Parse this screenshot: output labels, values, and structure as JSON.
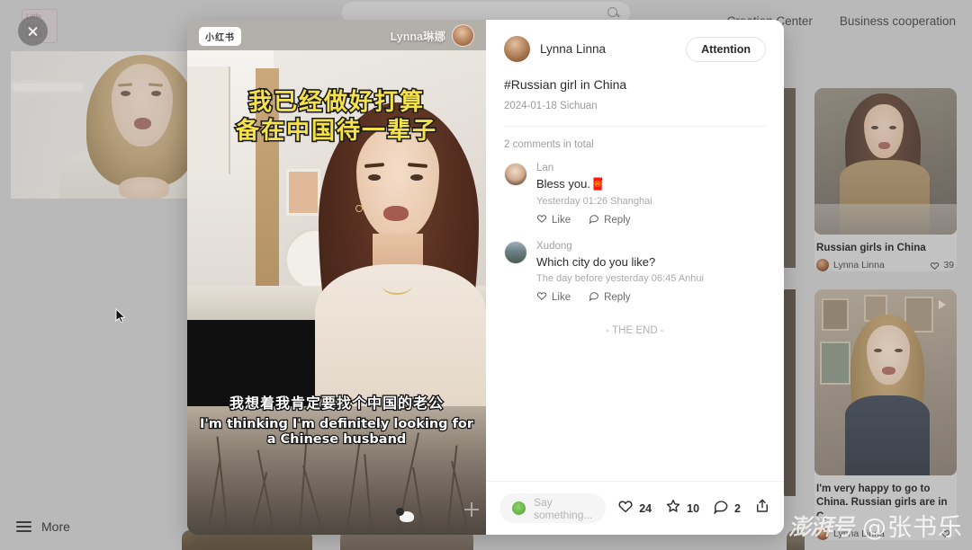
{
  "app": {
    "brand_label": "Little Red Book",
    "close_icon": "close-icon"
  },
  "background": {
    "nav_items": [
      {
        "label": "Creation Center"
      },
      {
        "label": "Business cooperation"
      }
    ],
    "search_placeholder": "",
    "sidebar_more": "More",
    "feed_cards": [
      {
        "title": "Russian girls in China",
        "author": "Lynna Linna",
        "likes": "39"
      },
      {
        "title": "I'm very happy to go to China. Russian girls are in C.",
        "author": "Lynna Linna",
        "likes": ""
      }
    ]
  },
  "video": {
    "platform_logo": "小红书",
    "author_name": "Lynna琳娜",
    "headline_line1": "我已经做好打算",
    "headline_line2": "备在中国待一辈子",
    "subtitle_cn": "我想着我肯定要找个中国的老公",
    "subtitle_en": "I'm thinking I'm definitely looking for a Chinese husband",
    "add_icon": "plus-icon"
  },
  "post": {
    "author": "Lynna Linna",
    "follow_button": "Attention",
    "title": "#Russian girl in China",
    "date_location": "2024-01-18 Sichuan",
    "comment_count_label": "2 comments in total",
    "end_marker": "- THE END -",
    "comments": [
      {
        "name": "Lan",
        "text": "Bless you.🧧",
        "meta": "Yesterday 01:26  Shanghai",
        "like_label": "Like",
        "reply_label": "Reply"
      },
      {
        "name": "Xudong",
        "text": "Which city do you like?",
        "meta": "The day before yesterday 06:45  Anhui",
        "like_label": "Like",
        "reply_label": "Reply"
      }
    ],
    "action_bar": {
      "comment_placeholder": "Say something...",
      "likes": "24",
      "collects": "10",
      "comments": "2",
      "share_icon": "share-icon"
    }
  },
  "watermark": {
    "logo": "澎湃号",
    "handle": "@张书乐"
  },
  "colors": {
    "accent_yellow": "#f5e14a",
    "background_dim": "#b8b8b8",
    "panel_white": "#ffffff"
  }
}
